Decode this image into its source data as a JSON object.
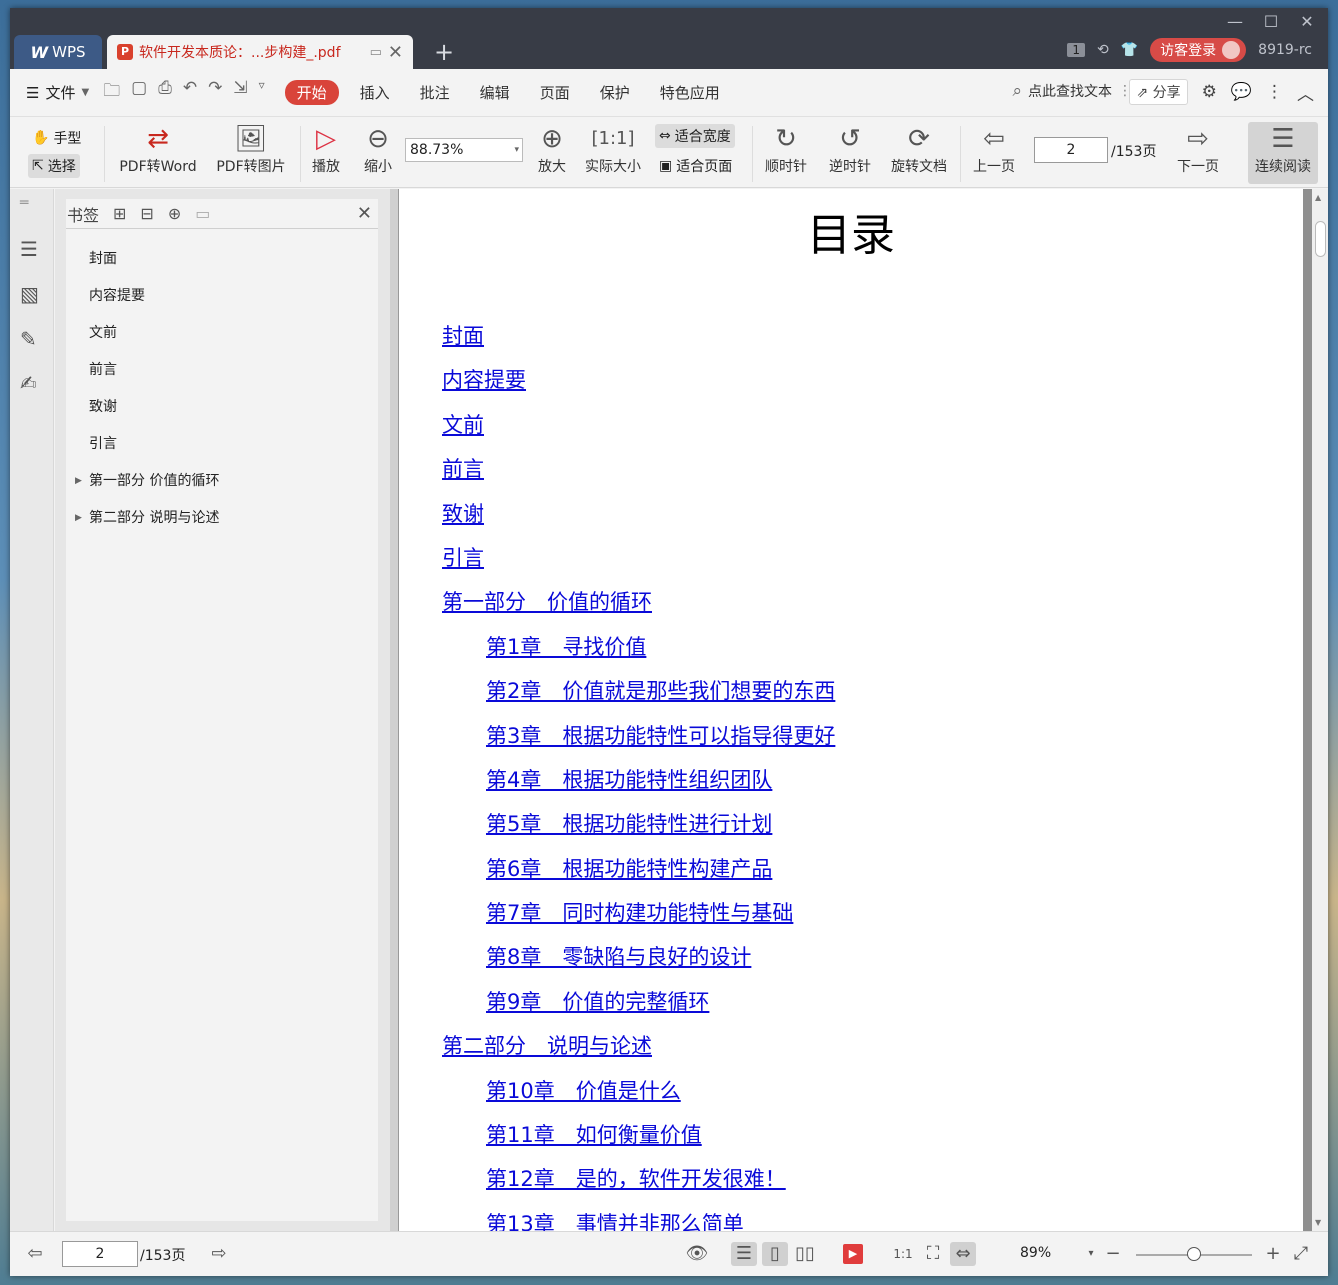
{
  "titlebar": {
    "app_tab": "WPS",
    "doc_tab": "软件开发本质论：...步构建_.pdf",
    "badge_count": "1",
    "login_label": "访客登录",
    "user_id": "8919-rc"
  },
  "menubar": {
    "file_label": "文件",
    "tabs": [
      "开始",
      "插入",
      "批注",
      "编辑",
      "页面",
      "保护",
      "特色应用"
    ],
    "active_tab": "开始",
    "search_placeholder": "点此查找文本",
    "share_label": "分享"
  },
  "ribbon": {
    "hand_label": "手型",
    "select_label": "选择",
    "pdf_word": "PDF转Word",
    "pdf_image": "PDF转图片",
    "play": "播放",
    "zoom_out": "缩小",
    "zoom_value": "88.73%",
    "zoom_in": "放大",
    "actual_size": "实际大小",
    "fit_width": "适合宽度",
    "fit_page": "适合页面",
    "clockwise": "顺时针",
    "counterclockwise": "逆时针",
    "rotate_doc": "旋转文档",
    "prev_page": "上一页",
    "page_current": "2",
    "page_total": "/153页",
    "next_page": "下一页",
    "continuous": "连续阅读"
  },
  "bookmarks": {
    "title": "书签",
    "items": [
      {
        "label": "封面",
        "expandable": false
      },
      {
        "label": "内容提要",
        "expandable": false
      },
      {
        "label": "文前",
        "expandable": false
      },
      {
        "label": "前言",
        "expandable": false
      },
      {
        "label": "致谢",
        "expandable": false
      },
      {
        "label": "引言",
        "expandable": false
      },
      {
        "label": "第一部分 价值的循环",
        "expandable": true
      },
      {
        "label": "第二部分 说明与论述",
        "expandable": true
      }
    ]
  },
  "document": {
    "heading": "目录",
    "toc": [
      {
        "text": "封面",
        "level": 0
      },
      {
        "text": "内容提要",
        "level": 0
      },
      {
        "text": "文前",
        "level": 0
      },
      {
        "text": "前言",
        "level": 0
      },
      {
        "text": "致谢",
        "level": 0
      },
      {
        "text": "引言",
        "level": 0
      },
      {
        "text": "第一部分　价值的循环",
        "level": 0
      },
      {
        "text": "第1章　寻找价值",
        "level": 1
      },
      {
        "text": "第2章　价值就是那些我们想要的东西",
        "level": 1
      },
      {
        "text": "第3章　根据功能特性可以指导得更好",
        "level": 1
      },
      {
        "text": "第4章　根据功能特性组织团队",
        "level": 1
      },
      {
        "text": "第5章　根据功能特性进行计划",
        "level": 1
      },
      {
        "text": "第6章　根据功能特性构建产品",
        "level": 1
      },
      {
        "text": "第7章　同时构建功能特性与基础",
        "level": 1
      },
      {
        "text": "第8章　零缺陷与良好的设计",
        "level": 1
      },
      {
        "text": "第9章　价值的完整循环",
        "level": 1
      },
      {
        "text": "第二部分　说明与论述",
        "level": 0
      },
      {
        "text": "第10章　价值是什么",
        "level": 1
      },
      {
        "text": "第11章　如何衡量价值",
        "level": 1
      },
      {
        "text": "第12章　是的，软件开发很难！",
        "level": 1
      },
      {
        "text": "第13章　事情并非那么简单",
        "level": 1
      }
    ]
  },
  "statusbar": {
    "page_current": "2",
    "page_total": "/153页",
    "zoom": "89%",
    "zoom_slider_fraction": 0.5
  }
}
